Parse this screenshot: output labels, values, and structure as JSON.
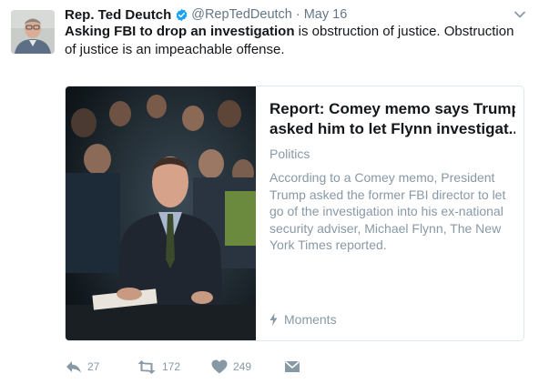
{
  "tweet": {
    "author_name": "Rep. Ted Deutch",
    "handle": "@RepTedDeutch",
    "separator": "·",
    "date": "May 16",
    "text_bold": "Asking FBI to drop an investigation",
    "text_rest": " is obstruction of justice. Obstruction of justice is an impeachable offense."
  },
  "card": {
    "title": "Report: Comey memo says Trump asked him to let Flynn investigat...",
    "title_line1": "Report: Comey memo says Trump",
    "title_line2": "asked him to let Flynn investigat...",
    "category": "Politics",
    "description": "According to a Comey memo, President Trump asked the former FBI director to let go of the investigation into his ex-national security adviser, Michael Flynn, The New York Times reported.",
    "footer_label": "Moments",
    "footer_icon": "lightning-icon"
  },
  "actions": {
    "reply_count": "27",
    "retweet_count": "172",
    "like_count": "249"
  },
  "colors": {
    "text": "#14171a",
    "secondary": "#657786",
    "muted": "#8899a6",
    "verified": "#1da1f2",
    "border": "#e1e8ed"
  }
}
